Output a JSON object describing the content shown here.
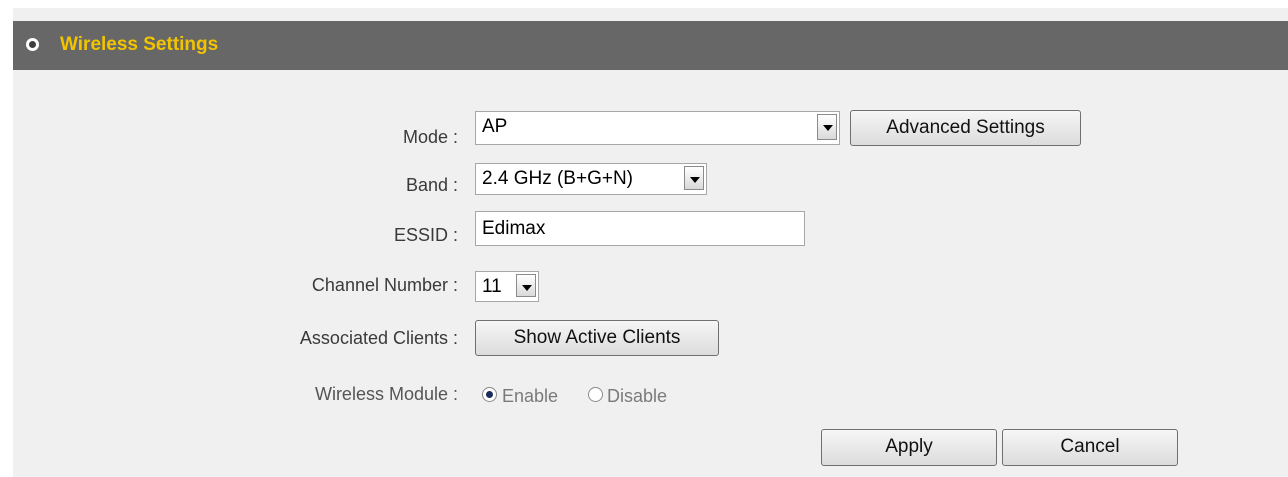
{
  "section": {
    "title": "Wireless Settings"
  },
  "mode": {
    "label": "Mode :",
    "value": "AP",
    "advanced_button": "Advanced Settings"
  },
  "band": {
    "label": "Band :",
    "value": "2.4 GHz (B+G+N)"
  },
  "essid": {
    "label": "ESSID :",
    "value": "Edimax"
  },
  "channel": {
    "label": "Channel Number :",
    "value": "11"
  },
  "clients": {
    "label": "Associated Clients :",
    "button": "Show Active Clients"
  },
  "module": {
    "label": "Wireless Module :",
    "enable_label": "Enable",
    "disable_label": "Disable",
    "selected": "Enable"
  },
  "actions": {
    "apply": "Apply",
    "cancel": "Cancel"
  },
  "colors": {
    "title_text": "#f2c400",
    "title_bar": "#676767",
    "panel_bg": "#f0f0f0"
  }
}
